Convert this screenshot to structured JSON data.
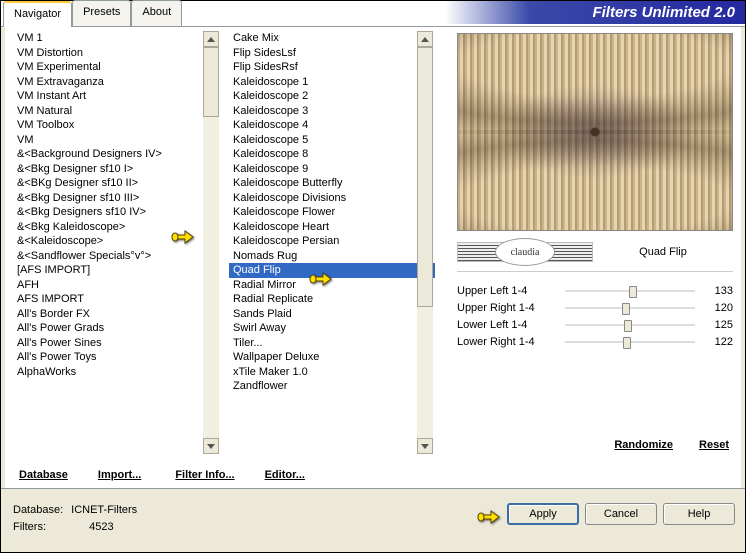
{
  "app_title": "Filters Unlimited 2.0",
  "tabs": {
    "navigator": "Navigator",
    "presets": "Presets",
    "about": "About"
  },
  "categories": [
    "VM 1",
    "VM Distortion",
    "VM Experimental",
    "VM Extravaganza",
    "VM Instant Art",
    "VM Natural",
    "VM Toolbox",
    "VM",
    "&<Background Designers IV>",
    "&<Bkg Designer sf10 I>",
    "&<BKg Designer sf10 II>",
    "&<Bkg Designer sf10 III>",
    "&<Bkg Designers sf10 IV>",
    "&<Bkg Kaleidoscope>",
    "&<Kaleidoscope>",
    "&<Sandflower Specials°v°>",
    "[AFS IMPORT]",
    "AFH",
    "AFS IMPORT",
    "All's Border FX",
    "All's Power Grads",
    "All's Power Sines",
    "All's Power Toys",
    "AlphaWorks"
  ],
  "categories_selected_index": 13,
  "filters": [
    "Cake Mix",
    "Flip SidesLsf",
    "Flip SidesRsf",
    "Kaleidoscope 1",
    "Kaleidoscope 2",
    "Kaleidoscope 3",
    "Kaleidoscope 4",
    "Kaleidoscope 5",
    "Kaleidoscope 8",
    "Kaleidoscope 9",
    "Kaleidoscope Butterfly",
    "Kaleidoscope Divisions",
    "Kaleidoscope Flower",
    "Kaleidoscope Heart",
    "Kaleidoscope Persian",
    "Nomads Rug",
    "Quad Flip",
    "Radial Mirror",
    "Radial Replicate",
    "Sands Plaid",
    "Swirl Away",
    "Tiler...",
    "Wallpaper Deluxe",
    "xTile Maker 1.0",
    "Zandflower"
  ],
  "filters_selected_index": 16,
  "current_filter_name": "Quad Flip",
  "watermark_text": "claudia",
  "params": [
    {
      "label": "Upper Left 1-4",
      "value": 133,
      "min": 1,
      "max": 255
    },
    {
      "label": "Upper Right 1-4",
      "value": 120,
      "min": 1,
      "max": 255
    },
    {
      "label": "Lower Left 1-4",
      "value": 125,
      "min": 1,
      "max": 255
    },
    {
      "label": "Lower Right 1-4",
      "value": 122,
      "min": 1,
      "max": 255
    }
  ],
  "link_buttons": {
    "database": "Database",
    "import": "Import...",
    "filter_info": "Filter Info...",
    "editor": "Editor...",
    "randomize": "Randomize",
    "reset": "Reset"
  },
  "footer": {
    "db_label": "Database:",
    "db_value": "ICNET-Filters",
    "ct_label": "Filters:",
    "ct_value": "4523"
  },
  "std_buttons": {
    "apply": "Apply",
    "cancel": "Cancel",
    "help": "Help"
  }
}
